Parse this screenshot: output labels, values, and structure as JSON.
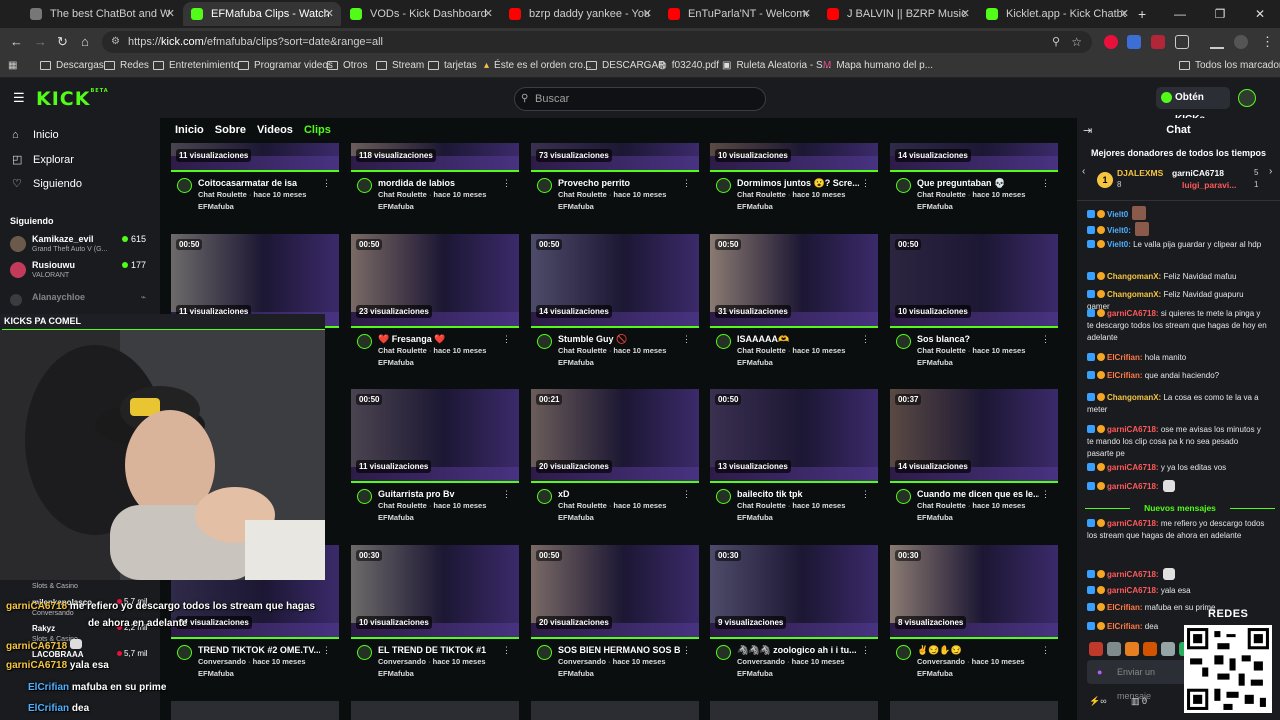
{
  "browser": {
    "tabs": [
      {
        "label": "The best ChatBot and Widgets",
        "color": "#cccccc"
      },
      {
        "label": "EFMafuba Clips - Watch Live on",
        "color": "#53fc18",
        "active": true
      },
      {
        "label": "VODs - Kick Dashboard",
        "color": "#53fc18"
      },
      {
        "label": "bzrp daddy yankee - YouTube",
        "color": "#ff0000"
      },
      {
        "label": "EnTuParla'NT - Welcome To Bo",
        "color": "#ff0000"
      },
      {
        "label": "J BALVIN || BZRP Music Session",
        "color": "#ff0000"
      },
      {
        "label": "Kicklet.app - Kick Chatbot and",
        "color": "#53fc18"
      }
    ],
    "url_prefix": "https://",
    "url_host": "kick.com",
    "url_path": "/efmafuba/clips?sort=date&range=all",
    "bookmarks": [
      "Descargas",
      "Redes",
      "Entretenimiento",
      "Programar videos",
      "Otros",
      "Stream",
      "tarjetas",
      "Éste es el orden cro...",
      "DESCARGAR",
      "f03240.pdf",
      "Ruleta Aleatoria - S...",
      "Mapa humano del p..."
    ],
    "all_bookmarks": "Todos los marcadores"
  },
  "kick": {
    "logo": "KICK",
    "logo_beta": "BETA",
    "search_placeholder": "Buscar",
    "kicks_button": "Obtén KICKs"
  },
  "sidebar": {
    "nav": [
      {
        "label": "Inicio",
        "icon": "home-icon"
      },
      {
        "label": "Explorar",
        "icon": "compass-icon"
      },
      {
        "label": "Siguiendo",
        "icon": "heart-icon"
      }
    ],
    "following_title": "Siguiendo",
    "following": [
      {
        "name": "Kamikaze_evil",
        "game": "Grand Theft Auto V (G...",
        "viewers": "615"
      },
      {
        "name": "Rusiouwu",
        "game": "VALORANT",
        "viewers": "177"
      },
      {
        "name": "Alanaychloe",
        "game": "",
        "viewers": ""
      }
    ]
  },
  "channel_tabs": [
    "Inicio",
    "Sobre",
    "Videos",
    "Clips"
  ],
  "clips": [
    {
      "views": "11 visualizaciones",
      "duration": "",
      "title": "Coitocasarmatar de isa",
      "category": "Chat Roulette",
      "age": "hace 10 meses",
      "author": "EFMafuba"
    },
    {
      "views": "118 visualizaciones",
      "duration": "",
      "title": "mordida de labios",
      "category": "Chat Roulette",
      "age": "hace 10 meses",
      "author": "EFMafuba"
    },
    {
      "views": "73 visualizaciones",
      "duration": "",
      "title": "Provecho perrito",
      "category": "Chat Roulette",
      "age": "hace 10 meses",
      "author": "EFMafuba"
    },
    {
      "views": "10 visualizaciones",
      "duration": "",
      "title": "Dormimos juntos 😮? Scre...",
      "category": "Chat Roulette",
      "age": "hace 10 meses",
      "author": "EFMafuba"
    },
    {
      "views": "14 visualizaciones",
      "duration": "",
      "title": "Que preguntaban 💀",
      "category": "Chat Roulette",
      "age": "hace 10 meses",
      "author": "EFMafuba"
    },
    {
      "views": "11 visualizaciones",
      "duration": "00:50",
      "title": "",
      "category": "",
      "age": "",
      "author": ""
    },
    {
      "views": "23 visualizaciones",
      "duration": "00:50",
      "title": "❤️ Fresanga ❤️",
      "category": "Chat Roulette",
      "age": "hace 10 meses",
      "author": "EFMafuba"
    },
    {
      "views": "14 visualizaciones",
      "duration": "00:50",
      "title": "Stumble Guy 🚫",
      "category": "Chat Roulette",
      "age": "hace 10 meses",
      "author": "EFMafuba"
    },
    {
      "views": "31 visualizaciones",
      "duration": "00:50",
      "title": "ISAAAAA🫶",
      "category": "Chat Roulette",
      "age": "hace 10 meses",
      "author": "EFMafuba"
    },
    {
      "views": "10 visualizaciones",
      "duration": "00:50",
      "title": "Sos blanca?",
      "category": "Chat Roulette",
      "age": "hace 10 meses",
      "author": "EFMafuba"
    },
    {
      "views": "11 visualizaciones",
      "duration": "00:50",
      "title": "Guitarrista pro Bv",
      "category": "Chat Roulette",
      "age": "hace 10 meses",
      "author": "EFMafuba"
    },
    {
      "views": "20 visualizaciones",
      "duration": "00:21",
      "title": "xD",
      "category": "Chat Roulette",
      "age": "hace 10 meses",
      "author": "EFMafuba"
    },
    {
      "views": "13 visualizaciones",
      "duration": "00:50",
      "title": "bailecito tik tpk",
      "category": "Chat Roulette",
      "age": "hace 10 meses",
      "author": "EFMafuba"
    },
    {
      "views": "14 visualizaciones",
      "duration": "00:37",
      "title": "Cuando me dicen que es le...",
      "category": "Chat Roulette",
      "age": "hace 10 meses",
      "author": "EFMafuba"
    },
    {
      "views": "24 visualizaciones",
      "duration": "",
      "title": "TREND TIKTOK #2 OME.TV...",
      "category": "Conversando",
      "age": "hace 10 meses",
      "author": "EFMafuba"
    },
    {
      "views": "10 visualizaciones",
      "duration": "00:30",
      "title": "EL TREND DE TIKTOK #1",
      "category": "Conversando",
      "age": "hace 10 meses",
      "author": "EFMafuba"
    },
    {
      "views": "20 visualizaciones",
      "duration": "00:50",
      "title": "SOS BIEN HERMANO SOS B...",
      "category": "Conversando",
      "age": "hace 10 meses",
      "author": "EFMafuba"
    },
    {
      "views": "9 visualizaciones",
      "duration": "00:30",
      "title": "🦓🦓🦓 zoologico ah i i tu...",
      "category": "Conversando",
      "age": "hace 10 meses",
      "author": "EFMafuba"
    },
    {
      "views": "8 visualizaciones",
      "duration": "00:30",
      "title": "✌️😏✋😏",
      "category": "Conversando",
      "age": "hace 10 meses",
      "author": "EFMafuba"
    }
  ],
  "overlay": {
    "cam_title": "KICKS PA COMEL",
    "chat": [
      {
        "user": "garniCA6718",
        "text": "me refiero yo descargo todos los stream que hagas"
      },
      {
        "user": "",
        "text": "de ahora en adelante"
      },
      {
        "user": "garniCA6718",
        "text": ""
      },
      {
        "user": "garniCA6718",
        "text": "yala esa"
      },
      {
        "user": "ElCrifian",
        "text": "mafuba en su prime"
      },
      {
        "user": "ElCrifian",
        "text": "dea"
      }
    ],
    "under": [
      {
        "name": "Slots & Casino",
        "viewers": ""
      },
      {
        "name": "milenkapolasco",
        "viewers": "5,7 mil"
      },
      {
        "name": "Conversando",
        "viewers": ""
      },
      {
        "name": "Rakyz",
        "viewers": "2,2 mil"
      },
      {
        "name": "Slots & Casino",
        "viewers": ""
      },
      {
        "name": "LACOBRAAA",
        "viewers": "5,7 mil"
      }
    ]
  },
  "chat": {
    "title": "Chat",
    "top_donors_title": "Mejores donadores de todos los tiempos",
    "donors": [
      {
        "name": "DJALEXMS",
        "amount": "8"
      },
      {
        "name": "garniCA6718",
        "amount": "5"
      },
      {
        "name": "luigi_paravi...",
        "amount": "1"
      }
    ],
    "messages": [
      {
        "user": "Vielt0",
        "text": ""
      },
      {
        "user": "Vielt0:",
        "text": ""
      },
      {
        "user": "Vielt0:",
        "text": "Le valla pija guardar y clipear al hdp",
        "color": "#4fb0ff"
      },
      {
        "user": "ChangomanX:",
        "text": "Feliz Navidad mafuu",
        "color": "#f5c542"
      },
      {
        "user": "ChangomanX:",
        "text": "Feliz Navidad guapuru gamer",
        "color": "#f5c542"
      },
      {
        "user": "garniCA6718:",
        "text": "si quieres te mete la pinga y te descargo todos los stream que hagas de hoy en adelante",
        "color": "#ff5a5a"
      },
      {
        "user": "ElCrifian:",
        "text": "hola manito",
        "color": "#ff7a45"
      },
      {
        "user": "ElCrifian:",
        "text": "que andai haciendo?",
        "color": "#ff7a45"
      },
      {
        "user": "ChangomanX:",
        "text": "La cosa es como te la va a meter",
        "color": "#f5c542"
      },
      {
        "user": "garniCA6718:",
        "text": "ose me avisas los minutos y te mando los clip cosa pa k no sea pesado pasarte pe",
        "color": "#ff5a5a"
      },
      {
        "user": "garniCA6718:",
        "text": "y ya los editas vos",
        "color": "#ff5a5a"
      },
      {
        "user": "garniCA6718:",
        "text": "",
        "color": "#ff5a5a"
      },
      {
        "user": "garniCA6718:",
        "text": "me refiero yo descargo todos los stream que hagas de ahora en adelante",
        "color": "#ff5a5a"
      },
      {
        "user": "garniCA6718:",
        "text": "",
        "color": "#ff5a5a"
      },
      {
        "user": "garniCA6718:",
        "text": "yala esa",
        "color": "#ff5a5a"
      },
      {
        "user": "ElCrifian:",
        "text": "mafuba en su prime",
        "color": "#ff7a45"
      },
      {
        "user": "ElCrifian:",
        "text": "dea",
        "color": "#ff7a45"
      }
    ],
    "new_messages": "Nuevos mensajes",
    "input_placeholder": "Enviar un mensaje",
    "footer_count": "0",
    "redes_label": "REDES"
  }
}
